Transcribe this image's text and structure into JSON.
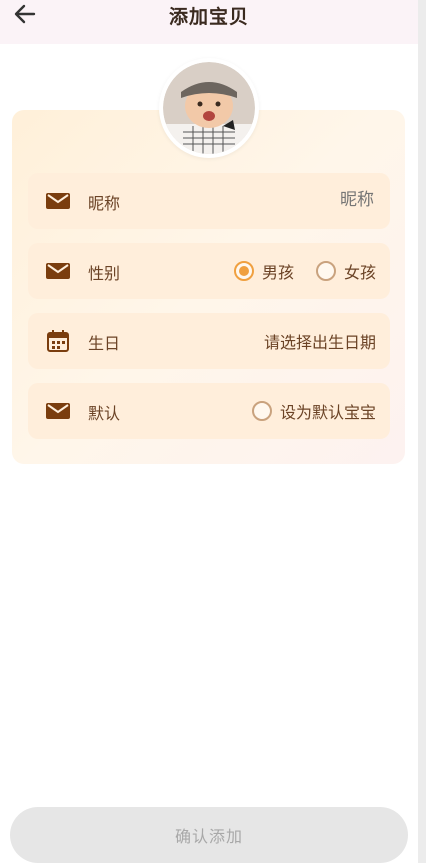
{
  "header": {
    "title": "添加宝贝",
    "back_icon": "arrow-left-icon"
  },
  "avatar": {
    "icon": "baby-photo"
  },
  "form": {
    "nickname": {
      "label": "昵称",
      "placeholder": "昵称",
      "icon": "mail-icon"
    },
    "gender": {
      "label": "性别",
      "icon": "mail-icon",
      "options": [
        {
          "label": "男孩",
          "selected": true
        },
        {
          "label": "女孩",
          "selected": false
        }
      ]
    },
    "birthday": {
      "label": "生日",
      "value": "请选择出生日期",
      "icon": "calendar-icon"
    },
    "default": {
      "label": "默认",
      "option_label": "设为默认宝宝",
      "checked": false,
      "icon": "mail-icon"
    }
  },
  "confirm": {
    "label": "确认添加"
  },
  "colors": {
    "accent": "#f0a040",
    "icon_brown": "#7a3d0e",
    "row_bg": "#ffeedb",
    "button_disabled_bg": "#e6e6e6"
  }
}
